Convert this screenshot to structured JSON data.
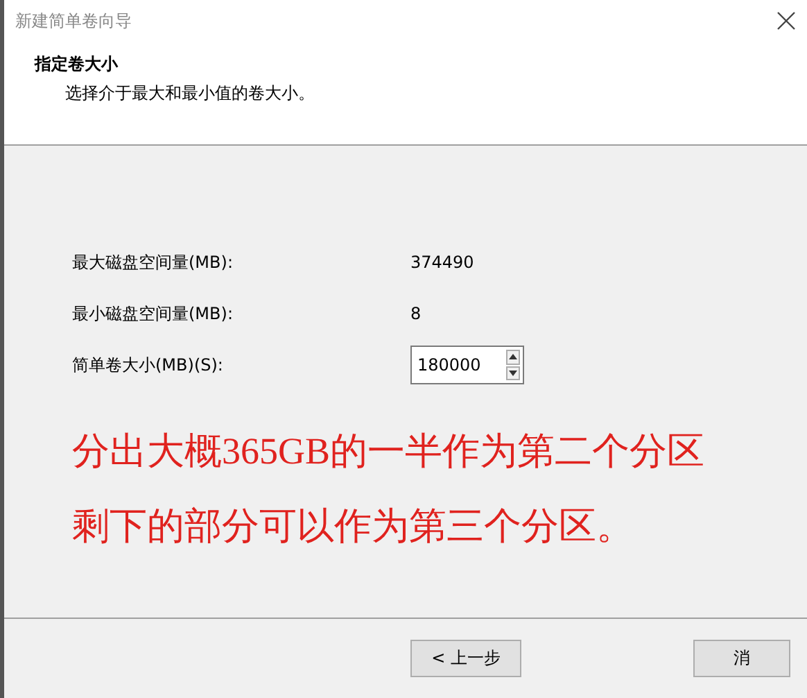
{
  "window": {
    "title": "新建简单卷向导"
  },
  "header": {
    "title": "指定卷大小",
    "subtitle": "选择介于最大和最小值的卷大小。"
  },
  "fields": [
    {
      "kind": "text",
      "label": "最大磁盘空间量(MB):",
      "value": "374490"
    },
    {
      "kind": "text",
      "label": "最小磁盘空间量(MB):",
      "value": "8"
    },
    {
      "kind": "spin",
      "label": "简单卷大小(MB)(S):",
      "value": "180000"
    }
  ],
  "annotation": [
    "分出大概365GB的一半作为第二个分区",
    "剩下的部分可以作为第三个分区。"
  ],
  "buttons": [
    {
      "label": "< 上一步",
      "kind": "back"
    },
    {
      "label": "消",
      "kind": "cancel"
    }
  ]
}
